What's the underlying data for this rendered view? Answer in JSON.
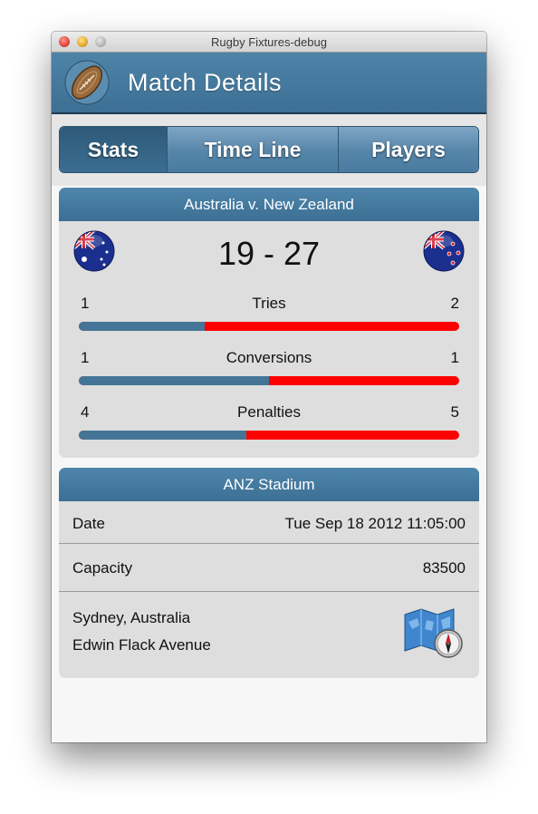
{
  "window": {
    "title": "Rugby Fixtures-debug"
  },
  "header": {
    "title": "Match Details",
    "icon": "rugby-ball-icon"
  },
  "tabs": [
    {
      "label": "Stats",
      "active": true
    },
    {
      "label": "Time Line",
      "active": false
    },
    {
      "label": "Players",
      "active": false
    }
  ],
  "match": {
    "title": "Australia v. New Zealand",
    "home_flag": "australia-flag-icon",
    "away_flag": "new-zealand-flag-icon",
    "score": "19 - 27",
    "stats": [
      {
        "label": "Tries",
        "home": "1",
        "away": "2",
        "home_share": 0.33
      },
      {
        "label": "Conversions",
        "home": "1",
        "away": "1",
        "home_share": 0.5
      },
      {
        "label": "Penalties",
        "home": "4",
        "away": "5",
        "home_share": 0.44
      }
    ]
  },
  "venue": {
    "name": "ANZ Stadium",
    "date_label": "Date",
    "date_value": "Tue Sep 18 2012 11:05:00",
    "capacity_label": "Capacity",
    "capacity_value": "83500",
    "address_line1": "Sydney, Australia",
    "address_line2": "Edwin Flack Avenue",
    "map_icon": "map-compass-icon"
  },
  "colors": {
    "header_blue": "#3c6f93",
    "home_bar": "#447596",
    "away_bar": "#ff0000"
  }
}
